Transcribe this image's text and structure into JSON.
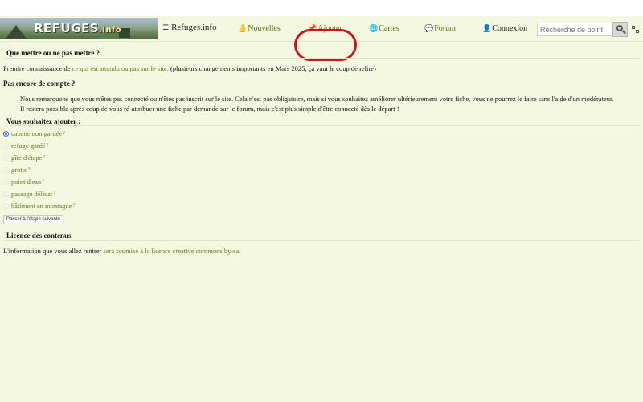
{
  "header": {
    "logo_text": "REFUGES",
    "logo_suffix": ".info",
    "site_name": "Refuges.info",
    "nav": [
      {
        "label": "Nouvelles",
        "icon": "bell-icon"
      },
      {
        "label": "Ajouter",
        "icon": "pushpin-icon"
      },
      {
        "label": "Cartes",
        "icon": "globe-icon"
      },
      {
        "label": "Forum",
        "icon": "speech-bubble-icon"
      },
      {
        "label": "Connexion",
        "icon": "user-icon"
      }
    ],
    "search_placeholder": "Recherche de point"
  },
  "sections": {
    "what_title": "Que mettre ou ne pas mettre ?",
    "what_text_before": "Prendre connaissance de ",
    "what_link": "ce qui est attendu ou pas sur le site.",
    "what_text_after": " (plusieurs changements importants en Mars 2025, ça vaut le coup de relire)",
    "account_title": "Pas encore de compte ?",
    "account_text": "Nous remarquons que vous n'êtes pas connecté ou n'êtes pas inscrit sur le site. Cela n'est pas obligatoire, mais si vous souhaitez améliorer ultérieurement votre fiche, vous ne pourrez le faire sans l'aide d'un modérateur. Il restera possible après coup de vous ré-attribuer une fiche par demande sur le forum, mais c'est plus simple d'être connecté dès le départ !",
    "add_title": "Vous souhaitez ajouter :",
    "options": [
      {
        "label": "cabane non gardée",
        "checked": true
      },
      {
        "label": "refuge gardé",
        "checked": false
      },
      {
        "label": "gîte d'étape",
        "checked": false
      },
      {
        "label": "grotte",
        "checked": false
      },
      {
        "label": "point d'eau",
        "checked": false
      },
      {
        "label": "passage délicat",
        "checked": false
      },
      {
        "label": "bâtiment en montagne",
        "checked": false
      }
    ],
    "help_mark": "?",
    "next_button": "Passer à l'étape suivante",
    "license_title": "Licence des contenus",
    "license_text_before": "L'information que vous allez rentrer ",
    "license_link": "sera soumise à la licence creative commons by-sa."
  },
  "colors": {
    "background": "#f4f8e0",
    "link": "#5b7d1a",
    "highlight_circle": "#c8141c"
  }
}
